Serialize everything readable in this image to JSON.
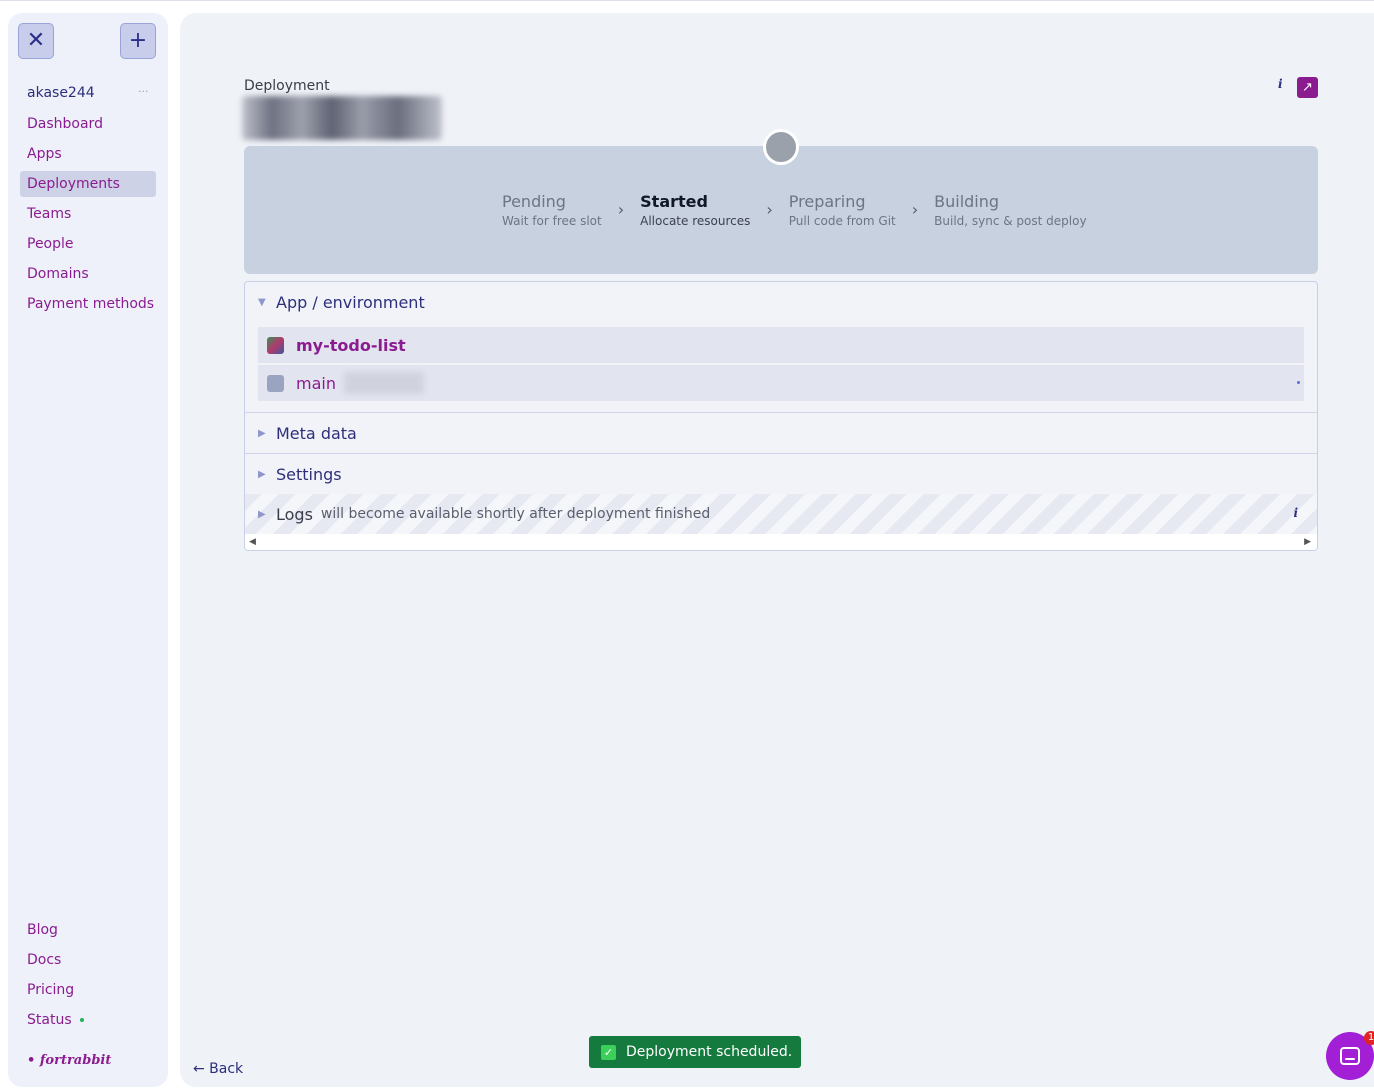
{
  "sidebar": {
    "close_icon": "✕",
    "add_icon": "+",
    "user": "akase244",
    "user_more": "···",
    "nav": [
      {
        "label": "Dashboard",
        "active": false
      },
      {
        "label": "Apps",
        "active": false
      },
      {
        "label": "Deployments",
        "active": true
      },
      {
        "label": "Teams",
        "active": false
      },
      {
        "label": "People",
        "active": false
      },
      {
        "label": "Domains",
        "active": false
      },
      {
        "label": "Payment methods",
        "active": false
      }
    ],
    "footer": [
      "Blog",
      "Docs",
      "Pricing",
      "Status"
    ],
    "brand": "• fortrabbit"
  },
  "header": {
    "label": "Deployment",
    "info": "i",
    "external_icon": "↗"
  },
  "progress": {
    "steps": [
      {
        "title": "Pending",
        "subtitle": "Wait for free slot"
      },
      {
        "title": "Started",
        "subtitle": "Allocate resources"
      },
      {
        "title": "Preparing",
        "subtitle": "Pull code from Git"
      },
      {
        "title": "Building",
        "subtitle": "Build, sync & post deploy"
      }
    ],
    "current_step": 1,
    "separator": "›"
  },
  "sections": {
    "app_env": {
      "title": "App / environment",
      "app_name": "my-todo-list",
      "branch": "main"
    },
    "meta": {
      "title": "Meta data"
    },
    "settings": {
      "title": "Settings"
    },
    "logs": {
      "title": "Logs",
      "note": "will become available shortly after deployment finished",
      "info": "i"
    }
  },
  "footer": {
    "back": "← Back"
  },
  "toast": {
    "check": "✓",
    "message": "Deployment scheduled."
  },
  "chat": {
    "badge": "1"
  },
  "colors": {
    "brand": "#8a1c8f",
    "navy": "#2d2f7a",
    "toast": "#157a3d",
    "chat": "#a21fd6"
  }
}
